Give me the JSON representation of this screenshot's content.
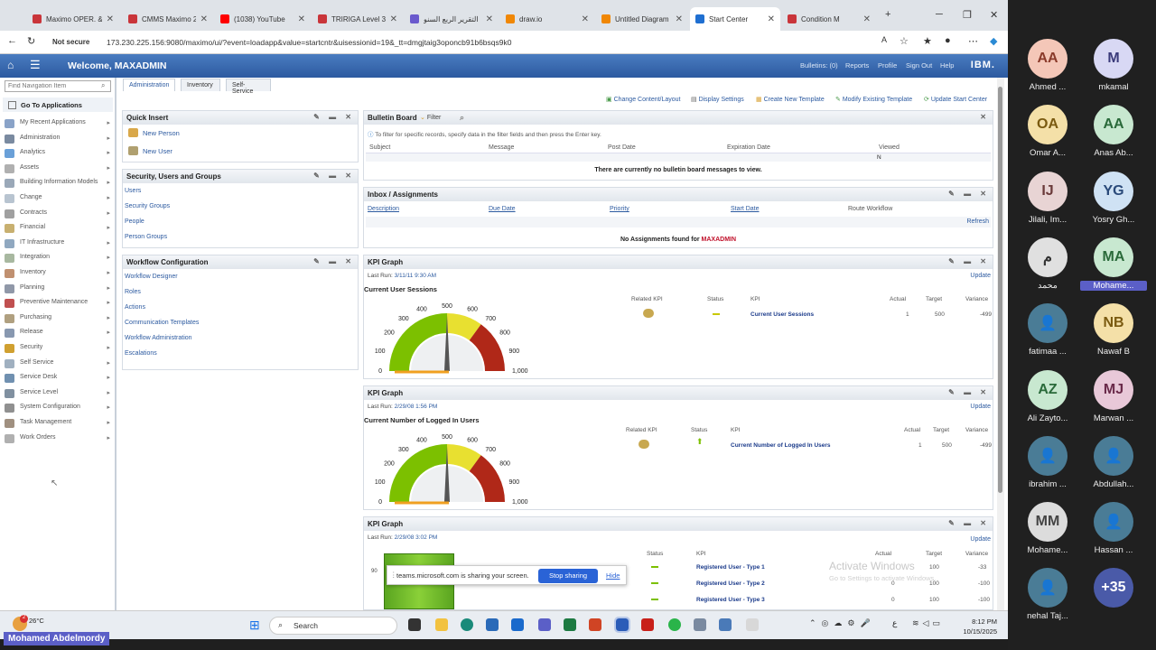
{
  "browser": {
    "tabs": [
      {
        "title": "Maximo OPER. & M",
        "color": "#c9353a"
      },
      {
        "title": "CMMS Maximo 2(",
        "color": "#c9353a"
      },
      {
        "title": "(1038) YouTube",
        "color": "#ff0000"
      },
      {
        "title": "TRIRIGA Level 3 D",
        "color": "#c9353a"
      },
      {
        "title": "التقرير الربع السنو",
        "color": "#6a5acd"
      },
      {
        "title": "draw.io",
        "color": "#f08705"
      },
      {
        "title": "Untitled Diagram",
        "color": "#f08705"
      },
      {
        "title": "Start Center",
        "color": "#1f6fd1"
      },
      {
        "title": "Condition M",
        "color": "#c9353a"
      }
    ],
    "new_tab": "+",
    "not_secure": "Not secure",
    "url": "173.230.225.156:9080/maximo/ui/?event=loadapp&value=startcntr&uisessionid=19&_tt=dmgjtaig3oponcb91b6bsqs9k0"
  },
  "header": {
    "welcome": "Welcome, MAXADMIN",
    "links": [
      "Bulletins: (0)",
      "Reports",
      "Profile",
      "Sign Out",
      "Help"
    ],
    "brand": "IBM."
  },
  "leftnav": {
    "find_placeholder": "Find Navigation Item",
    "goto": "Go To Applications",
    "items": [
      {
        "label": "My Recent Applications",
        "color": "#8aa3c8"
      },
      {
        "label": "Administration",
        "color": "#7a8aa0"
      },
      {
        "label": "Analytics",
        "color": "#6aa0d8"
      },
      {
        "label": "Assets",
        "color": "#b0b0b0"
      },
      {
        "label": "Building Information Models",
        "color": "#9aa8b8"
      },
      {
        "label": "Change",
        "color": "#b8c4d0"
      },
      {
        "label": "Contracts",
        "color": "#a0a0a0"
      },
      {
        "label": "Financial",
        "color": "#c8b070"
      },
      {
        "label": "IT Infrastructure",
        "color": "#90a8c0"
      },
      {
        "label": "Integration",
        "color": "#a8b8a0"
      },
      {
        "label": "Inventory",
        "color": "#c09070"
      },
      {
        "label": "Planning",
        "color": "#9098a8"
      },
      {
        "label": "Preventive Maintenance",
        "color": "#c05050"
      },
      {
        "label": "Purchasing",
        "color": "#b0a080"
      },
      {
        "label": "Release",
        "color": "#8898b0"
      },
      {
        "label": "Security",
        "color": "#d0a030"
      },
      {
        "label": "Self Service",
        "color": "#a0b0c0"
      },
      {
        "label": "Service Desk",
        "color": "#7090b0"
      },
      {
        "label": "Service Level",
        "color": "#8090a0"
      },
      {
        "label": "System Configuration",
        "color": "#909090"
      },
      {
        "label": "Task Management",
        "color": "#a09080"
      },
      {
        "label": "Work Orders",
        "color": "#b0b0b0"
      }
    ]
  },
  "apptabs": [
    "Administration",
    "Inventory",
    "Self-Service"
  ],
  "actions": [
    "Change Content/Layout",
    "Display Settings",
    "Create New Template",
    "Modify Existing Template",
    "Update Start Center"
  ],
  "quick_insert": {
    "title": "Quick Insert",
    "items": [
      "New Person",
      "New User"
    ]
  },
  "security": {
    "title": "Security, Users and Groups",
    "items": [
      "Users",
      "Security Groups",
      "People",
      "Person Groups"
    ]
  },
  "workflow": {
    "title": "Workflow Configuration",
    "items": [
      "Workflow Designer",
      "Roles",
      "Actions",
      "Communication Templates",
      "Workflow Administration",
      "Escalations"
    ]
  },
  "bulletin": {
    "title": "Bulletin Board",
    "filter": "Filter",
    "hint": "To filter for specific records, specify data in the filter fields and then press the Enter key.",
    "columns": [
      "Subject",
      "Message",
      "Post Date",
      "Expiration Date",
      "Viewed"
    ],
    "viewed_filter": "N",
    "empty": "There are currently no bulletin board messages to view."
  },
  "inbox": {
    "title": "Inbox / Assignments",
    "columns": [
      "Description",
      "Due Date",
      "Priority",
      "Start Date",
      "Route Workflow"
    ],
    "refresh": "Refresh",
    "empty_prefix": "No Assignments found for",
    "user": "MAXADMIN"
  },
  "kpis": [
    {
      "title": "KPI Graph",
      "update": "Update",
      "last_run_label": "Last Run:",
      "last_run": "3/11/11 9:30 AM",
      "name": "Current User Sessions",
      "status_color": "#c8c800",
      "actual": "1",
      "target": "500",
      "variance": "-499"
    },
    {
      "title": "KPI Graph",
      "update": "Update",
      "last_run_label": "Last Run:",
      "last_run": "2/29/08 1:56 PM",
      "name": "Current Number of Logged In Users",
      "status_color": "#7cc000",
      "actual": "1",
      "target": "500",
      "variance": "-499"
    },
    {
      "title": "KPI Graph",
      "update": "Update",
      "last_run_label": "Last Run:",
      "last_run": "2/29/08 3:02 PM",
      "rows": [
        {
          "name": "Registered User - Type 1",
          "actual": "",
          "target": "100",
          "variance": "-33"
        },
        {
          "name": "Registered User - Type 2",
          "actual": "0",
          "target": "100",
          "variance": "-100"
        },
        {
          "name": "Registered User - Type 3",
          "actual": "0",
          "target": "100",
          "variance": "-100"
        }
      ],
      "axis_label": "90"
    }
  ],
  "kpi_headers": [
    "Related KPI",
    "Status",
    "KPI",
    "Actual",
    "Target",
    "Variance"
  ],
  "gauge": {
    "ticks": [
      "0",
      "100",
      "200",
      "300",
      "400",
      "500",
      "600",
      "700",
      "800",
      "900",
      "1,000"
    ],
    "value": 500
  },
  "share_bar": {
    "text": "teams.microsoft.com is sharing your screen.",
    "stop": "Stop sharing",
    "hide": "Hide"
  },
  "watermark": {
    "line1": "Activate Windows",
    "line2": "Go to Settings to activate Windows."
  },
  "taskbar": {
    "temp": "26°C",
    "badge": "2",
    "search": "Search",
    "time": "8:12 PM",
    "date": "10/15/2025",
    "tray_lang": "ع"
  },
  "participants": [
    {
      "initials": "AA",
      "name": "Ahmed ...",
      "bg": "#f4c7b8",
      "fg": "#8a3a2a"
    },
    {
      "initials": "M",
      "name": "mkamal",
      "bg": "#d8d8f4",
      "fg": "#3a3a7a"
    },
    {
      "initials": "OA",
      "name": "Omar A...",
      "bg": "#f4e0a8",
      "fg": "#7a5a10"
    },
    {
      "initials": "AA",
      "name": "Anas Ab...",
      "bg": "#c8e8d0",
      "fg": "#2a6a3a"
    },
    {
      "initials": "IJ",
      "name": "Jilali, Im...",
      "bg": "#e8d4d4",
      "fg": "#6a3a3a"
    },
    {
      "initials": "YG",
      "name": "Yosry Gh...",
      "bg": "#cfe2f4",
      "fg": "#2a4a7a"
    },
    {
      "initials": "م",
      "name": "محمد",
      "bg": "#e0e0e0",
      "fg": "#333333"
    },
    {
      "initials": "MA",
      "name": "Mohame...",
      "bg": "#c8e8d0",
      "fg": "#2a6a3a",
      "highlight": true
    },
    {
      "initials": "",
      "name": "fatimaa ...",
      "bg": "#4a7c96",
      "fg": "#ffffff"
    },
    {
      "initials": "NB",
      "name": "Nawaf B",
      "bg": "#f4e0a8",
      "fg": "#7a5a10"
    },
    {
      "initials": "AZ",
      "name": "Ali Zayto...",
      "bg": "#c8e8d0",
      "fg": "#2a6a3a"
    },
    {
      "initials": "MJ",
      "name": "Marwan ...",
      "bg": "#e8c8d8",
      "fg": "#6a2a4a"
    },
    {
      "initials": "",
      "name": "ibrahim ...",
      "bg": "#4a7c96",
      "fg": "#ffffff"
    },
    {
      "initials": "",
      "name": "Abdullah...",
      "bg": "#4a7c96",
      "fg": "#ffffff"
    },
    {
      "initials": "MM",
      "name": "Mohame...",
      "bg": "#dcdcdc",
      "fg": "#444444"
    },
    {
      "initials": "",
      "name": "Hassan ...",
      "bg": "#4a7c96",
      "fg": "#ffffff"
    },
    {
      "initials": "",
      "name": "nehal Taj...",
      "bg": "#4a7c96",
      "fg": "#ffffff"
    },
    {
      "initials": "+35",
      "name": "",
      "bg": "#4a5aa8",
      "fg": "#ffffff"
    }
  ],
  "presenter": "Mohamed Abdelmordy"
}
